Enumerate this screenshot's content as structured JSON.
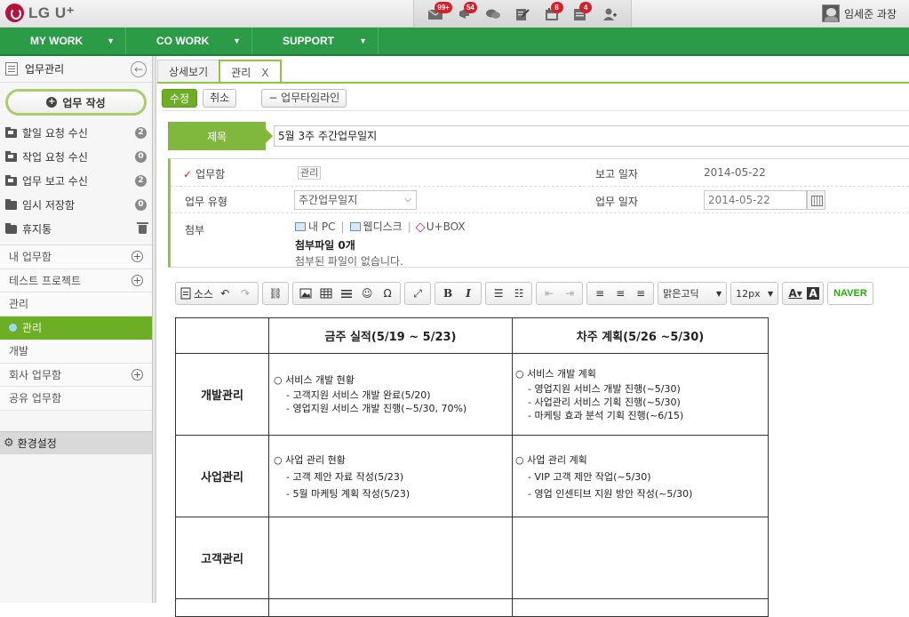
{
  "brand": {
    "logo_text": "LG U⁺"
  },
  "top_icons": [
    {
      "name": "mail",
      "badge": "99+"
    },
    {
      "name": "notice",
      "badge": "54"
    },
    {
      "name": "chat",
      "badge": ""
    },
    {
      "name": "report",
      "badge": ""
    },
    {
      "name": "schedule",
      "badge": "8"
    },
    {
      "name": "approval",
      "badge": "4"
    },
    {
      "name": "add-user",
      "badge": ""
    }
  ],
  "user": {
    "name": "임세준 과장"
  },
  "mainnav": [
    {
      "label": "MY WORK"
    },
    {
      "label": "CO WORK"
    },
    {
      "label": "SUPPORT"
    }
  ],
  "sidebar": {
    "title": "업무관리",
    "write_button": "업무 작성",
    "boxes": [
      {
        "label": "할일 요청 수신",
        "count": "2"
      },
      {
        "label": "작업 요청 수신",
        "count": "0"
      },
      {
        "label": "업무 보고 수신",
        "count": "2"
      },
      {
        "label": "임시 저장함",
        "count": "0"
      },
      {
        "label": "휴지통",
        "count": ""
      }
    ],
    "groups": [
      {
        "label": "내 업무함",
        "addable": true
      },
      {
        "label": "테스트 프로젝트",
        "addable": true
      },
      {
        "label": "관리",
        "addable": false
      },
      {
        "label": "관리",
        "addable": false,
        "active": true
      },
      {
        "label": "개발",
        "addable": false
      },
      {
        "label": "회사 업무함",
        "addable": true
      },
      {
        "label": "공유 업무함",
        "addable": false
      }
    ],
    "settings": "환경설정"
  },
  "tabs": [
    {
      "label": "상세보기"
    },
    {
      "label": "관리",
      "close": "X"
    }
  ],
  "actions": {
    "edit": "수정",
    "cancel": "취소",
    "timeline": "업무타임라인"
  },
  "form": {
    "title_label": "제목",
    "title_value": "5월 3주 주간업무일지",
    "work_box_label": "업무함",
    "work_box_value": "관리",
    "report_date_label": "보고 일자",
    "report_date_value": "2014-05-22",
    "work_type_label": "업무 유형",
    "work_type_value": "주간업무일지",
    "work_date_label": "업무 일자",
    "work_date_value": "2014-05-22",
    "attach_label": "첨부",
    "attach_sources": [
      "내 PC",
      "웹디스크",
      "U+BOX"
    ],
    "attach_count": "첨부파일 0개",
    "attach_empty": "첨부된 파일이 없습니다."
  },
  "editor": {
    "source_label": "소스",
    "font": "맑은고딕",
    "size": "12px",
    "naver": "NAVER"
  },
  "report_table": {
    "headers": [
      "",
      "금주 실적(5/19 ~ 5/23)",
      "차주 계획(5/26 ~5/30)"
    ],
    "rows": [
      {
        "label": "개발관리",
        "this_week": {
          "head": "○ 서비스 개발 현황",
          "items": [
            "- 고객지원 서비스 개발 완료(5/20)",
            "- 영업지원 서비스 개발 진행(~5/30, 70%)"
          ]
        },
        "next_week": {
          "head": "○ 서비스 개발 계획",
          "items": [
            "- 영업지원 서비스 개발 진행(~5/30)",
            "- 사업관리 서비스 기획 진행(~5/30)",
            "- 마케팅 효과 분석 기획 진행(~6/15)"
          ]
        }
      },
      {
        "label": "사업관리",
        "this_week": {
          "head": "○ 사업 관리 현황",
          "items": [
            "- 고객 제안 자료 작성(5/23)",
            "- 5월 마케팅 계획 작성(5/23)"
          ]
        },
        "next_week": {
          "head": "○ 사업 관리 계획",
          "items": [
            "- VIP 고객 제안 작업(~5/30)",
            "- 영업 인센티브 지원 방안 작성(~5/30)"
          ]
        }
      },
      {
        "label": "고객관리",
        "this_week": {
          "head": "",
          "items": []
        },
        "next_week": {
          "head": "",
          "items": []
        }
      }
    ]
  }
}
